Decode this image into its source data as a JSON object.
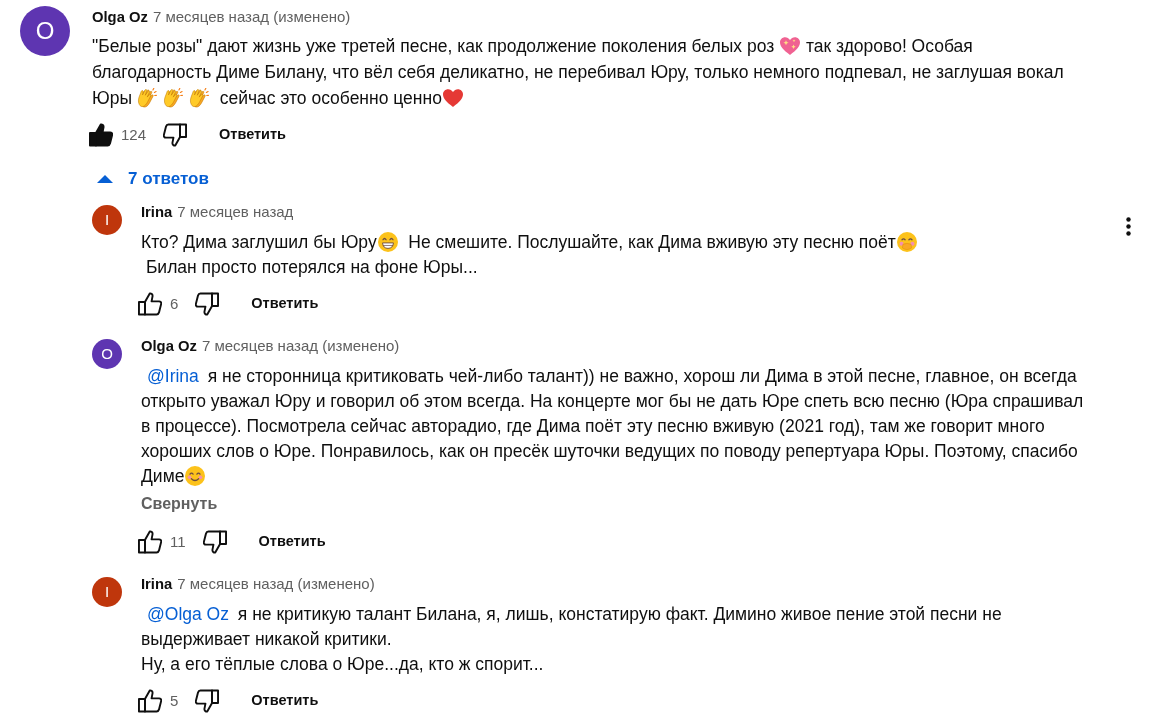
{
  "comment": {
    "author": {
      "name": "Olga Oz",
      "initial": "O",
      "color": "#5e35b1"
    },
    "time": "7 месяцев назад (изменено)",
    "body": [
      {
        "kind": "text",
        "text": "\"Белые розы\" дают жизнь уже третей песне, как продолжение поколения белых роз "
      },
      {
        "kind": "sparkleheart"
      },
      {
        "kind": "text",
        "text": " так здорово! Особая\nблагодарность Диме Билану, что вёл себя деликатно, не перебивал Юру, только немного подпевал, не заглушая вокал\nЮры "
      },
      {
        "kind": "clap"
      },
      {
        "kind": "clap"
      },
      {
        "kind": "clap"
      },
      {
        "kind": "text",
        "text": " сейчас это особенно ценно"
      },
      {
        "kind": "heart"
      }
    ],
    "liked": true,
    "disliked": false,
    "likes": "124",
    "reply_label": "Ответить"
  },
  "replies_toggle": {
    "label": "7 ответов",
    "expanded": true
  },
  "replies": [
    {
      "author": {
        "name": "Irina",
        "initial": "I",
        "color": "#bf360c"
      },
      "time": "7 месяцев назад",
      "hovered": true,
      "body": [
        {
          "kind": "text",
          "text": "Кто? Дима заглушил бы Юру"
        },
        {
          "kind": "grin"
        },
        {
          "kind": "text",
          "text": "  Не смешите. Послушайте, как Дима вживую эту песню поёт"
        },
        {
          "kind": "giggle"
        },
        {
          "kind": "text",
          "text": "\n Билан просто потерялся на фоне Юры..."
        }
      ],
      "liked": false,
      "disliked": false,
      "likes": "6",
      "reply_label": "Ответить"
    },
    {
      "author": {
        "name": "Olga Oz",
        "initial": "O",
        "color": "#5e35b1"
      },
      "time": "7 месяцев назад (изменено)",
      "hovered": false,
      "body": [
        {
          "kind": "mention",
          "text": "@Irina"
        },
        {
          "kind": "text",
          "text": " я не сторонница критиковать чей-либо талант)) не важно, хорош ли Дима в этой песне, главное, он всегда\nоткрыто уважал Юру и говорил об этом всегда. На концерте мог бы не дать Юре спеть всю песню (Юра спрашивал\nв процессе). Посмотрела сейчас авторадио, где Дима поёт эту песню вживую (2021 год), там же говорит много\nхороших слов о Юре. Понравилось, как он пресёк шуточки ведущих по поводу репертуара Юры. Поэтому, спасибо\nДиме"
        },
        {
          "kind": "smile"
        }
      ],
      "collapse_label": "Свернуть",
      "liked": false,
      "disliked": false,
      "likes": "11",
      "reply_label": "Ответить"
    },
    {
      "author": {
        "name": "Irina",
        "initial": "I",
        "color": "#bf360c"
      },
      "time": "7 месяцев назад (изменено)",
      "hovered": false,
      "body": [
        {
          "kind": "mention",
          "text": "@Olga Oz"
        },
        {
          "kind": "text",
          "text": " я не критикую талант Билана, я, лишь, констатирую факт. Димино живое пение этой песни не\nвыдерживает никакой критики.\nНу, а его тёплые слова о Юре...да, кто ж спорит..."
        }
      ],
      "liked": false,
      "disliked": false,
      "likes": "5",
      "reply_label": "Ответить"
    }
  ]
}
